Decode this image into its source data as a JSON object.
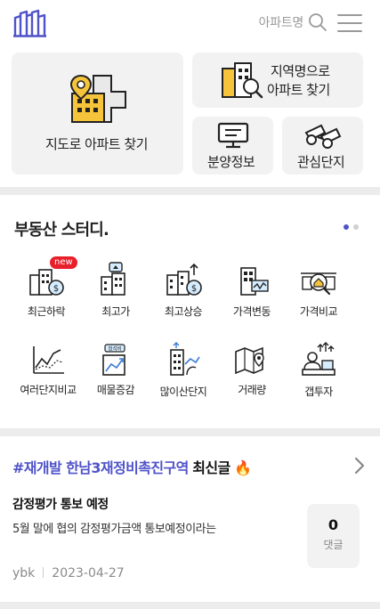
{
  "header": {
    "search_placeholder": "아파트명",
    "icons": [
      "building-logo-icon",
      "search-icon",
      "hamburger-menu-icon"
    ]
  },
  "top_menu": {
    "map_search": "지도로 아파트 찾기",
    "region_search_line1": "지역명으로",
    "region_search_line2": "아파트 찾기",
    "presale": "분양정보",
    "favorites": "관심단지"
  },
  "study": {
    "title": "부동산 스터디.",
    "pager": {
      "pages": 2,
      "active": 1
    },
    "colors": {
      "active_dot": "#4f52c9",
      "inactive_dot": "#d0d0d0",
      "badge": "#e8202a"
    },
    "items": [
      {
        "label": "최근하락",
        "icon": "recent-drop-icon",
        "badge": "new"
      },
      {
        "label": "최고가",
        "icon": "highest-price-icon"
      },
      {
        "label": "최고상승",
        "icon": "highest-rise-icon"
      },
      {
        "label": "가격변동",
        "icon": "price-change-icon"
      },
      {
        "label": "가격비교",
        "icon": "price-compare-icon"
      },
      {
        "label": "여러단지비교",
        "icon": "multi-compare-icon"
      },
      {
        "label": "매물증감",
        "icon": "listing-change-icon",
        "icon_tag": "정석비"
      },
      {
        "label": "많이산단지",
        "icon": "most-bought-icon"
      },
      {
        "label": "거래량",
        "icon": "trade-volume-icon"
      },
      {
        "label": "갭투자",
        "icon": "gap-investment-icon"
      }
    ]
  },
  "latest": {
    "tag": "#재개발 한남3재정비촉진구역",
    "suffix": "최신글",
    "flame": "🔥",
    "post": {
      "title": "감정평가 통보 예정",
      "snippet": "5월 말에 협의 감정평가금액 통보예정이라는",
      "comments": "0",
      "comments_label": "댓글",
      "author": "ybk",
      "date": "2023-04-27"
    }
  }
}
